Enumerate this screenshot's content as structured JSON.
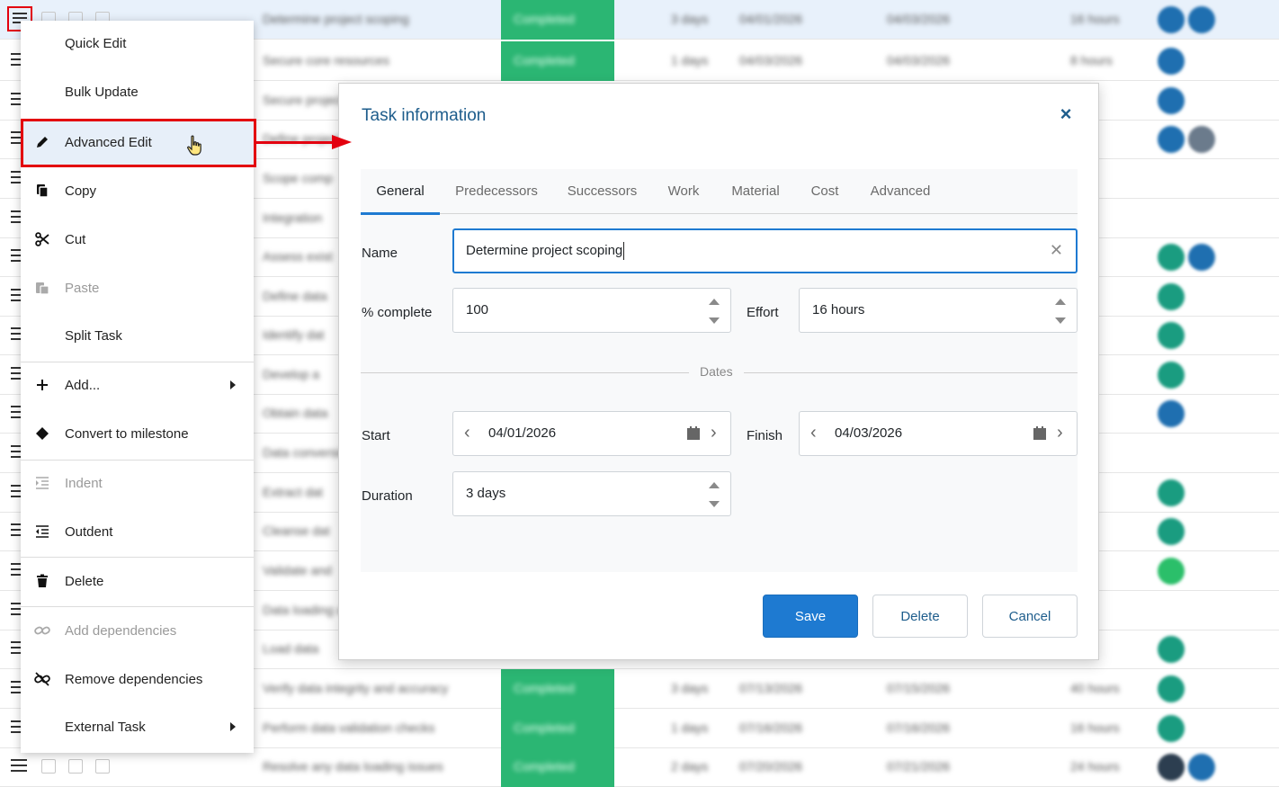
{
  "context_menu": {
    "items": [
      {
        "label": "Quick Edit",
        "icon": "none",
        "enabled": true
      },
      {
        "label": "Bulk Update",
        "icon": "none",
        "enabled": true
      },
      {
        "label": "Advanced Edit",
        "icon": "pencil-icon",
        "enabled": true,
        "highlighted": true
      },
      {
        "label": "Copy",
        "icon": "copy-icon",
        "enabled": true
      },
      {
        "label": "Cut",
        "icon": "scissors-icon",
        "enabled": true
      },
      {
        "label": "Paste",
        "icon": "paste-icon",
        "enabled": false
      },
      {
        "label": "Split Task",
        "icon": "none",
        "enabled": true
      },
      {
        "label": "Add...",
        "icon": "plus-icon",
        "enabled": true,
        "submenu": true
      },
      {
        "label": "Convert to milestone",
        "icon": "diamond-icon",
        "enabled": true
      },
      {
        "label": "Indent",
        "icon": "indent-icon",
        "enabled": false
      },
      {
        "label": "Outdent",
        "icon": "outdent-icon",
        "enabled": true
      },
      {
        "label": "Delete",
        "icon": "trash-icon",
        "enabled": true
      },
      {
        "label": "Add dependencies",
        "icon": "link-icon",
        "enabled": false
      },
      {
        "label": "Remove dependencies",
        "icon": "unlink-icon",
        "enabled": true
      },
      {
        "label": "External Task",
        "icon": "none",
        "enabled": true,
        "submenu": true
      }
    ]
  },
  "dialog": {
    "title": "Task information",
    "tabs": [
      "General",
      "Predecessors",
      "Successors",
      "Work",
      "Material",
      "Cost",
      "Advanced"
    ],
    "active_tab": "General",
    "fields": {
      "name_label": "Name",
      "name_value": "Determine project scoping",
      "percent_label": "% complete",
      "percent_value": "100",
      "effort_label": "Effort",
      "effort_value": "16 hours",
      "dates_divider": "Dates",
      "start_label": "Start",
      "start_value": "04/01/2026",
      "finish_label": "Finish",
      "finish_value": "04/03/2026",
      "duration_label": "Duration",
      "duration_value": "3 days"
    },
    "buttons": {
      "save": "Save",
      "delete": "Delete",
      "cancel": "Cancel"
    }
  },
  "grid": {
    "rows": [
      {
        "name": "Determine project scoping",
        "status": "Completed",
        "duration": "3 days",
        "start": "04/01/2026",
        "finish": "04/03/2026",
        "work": "16 hours"
      },
      {
        "name": "Secure core resources",
        "status": "Completed",
        "duration": "1 days",
        "start": "04/03/2026",
        "finish": "04/03/2026",
        "work": "8 hours"
      },
      {
        "name": "Secure project",
        "status": "",
        "duration": "",
        "start": "",
        "finish": "",
        "work": ""
      },
      {
        "name": "Define project",
        "status": "",
        "duration": "",
        "start": "",
        "finish": "",
        "work": ""
      },
      {
        "name": "Scope comp",
        "status": "",
        "duration": "",
        "start": "",
        "finish": "",
        "work": ""
      },
      {
        "name": "Integration",
        "status": "",
        "duration": "",
        "start": "",
        "finish": "",
        "work": ""
      },
      {
        "name": "Assess exist",
        "status": "",
        "duration": "",
        "start": "",
        "finish": "",
        "work": ""
      },
      {
        "name": "Define data",
        "status": "",
        "duration": "",
        "start": "",
        "finish": "",
        "work": ""
      },
      {
        "name": "Identify dat",
        "status": "",
        "duration": "",
        "start": "",
        "finish": "",
        "work": ""
      },
      {
        "name": "Develop a",
        "status": "",
        "duration": "",
        "start": "",
        "finish": "",
        "work": ""
      },
      {
        "name": "Obtain data",
        "status": "",
        "duration": "",
        "start": "",
        "finish": "",
        "work": ""
      },
      {
        "name": "Data conversion",
        "status": "",
        "duration": "",
        "start": "",
        "finish": "",
        "work": ""
      },
      {
        "name": "Extract dat",
        "status": "",
        "duration": "",
        "start": "",
        "finish": "",
        "work": ""
      },
      {
        "name": "Cleanse dat",
        "status": "",
        "duration": "",
        "start": "",
        "finish": "",
        "work": ""
      },
      {
        "name": "Validate and",
        "status": "",
        "duration": "",
        "start": "",
        "finish": "",
        "work": ""
      },
      {
        "name": "Data loading and",
        "status": "",
        "duration": "",
        "start": "",
        "finish": "",
        "work": ""
      },
      {
        "name": "Load data",
        "status": "",
        "duration": "",
        "start": "",
        "finish": "",
        "work": ""
      },
      {
        "name": "Verify data integrity and accuracy",
        "status": "Completed",
        "duration": "3 days",
        "start": "07/13/2026",
        "finish": "07/15/2026",
        "work": "40 hours"
      },
      {
        "name": "Perform data validation checks",
        "status": "Completed",
        "duration": "1 days",
        "start": "07/16/2026",
        "finish": "07/16/2026",
        "work": "16 hours"
      },
      {
        "name": "Resolve any data loading issues",
        "status": "Completed",
        "duration": "2 days",
        "start": "07/20/2026",
        "finish": "07/21/2026",
        "work": "24 hours"
      }
    ],
    "avatar_colors": [
      "#1f6fb0",
      "#1a9c80",
      "#2bbf6a",
      "#6b7b8c",
      "#2c3e50"
    ]
  }
}
